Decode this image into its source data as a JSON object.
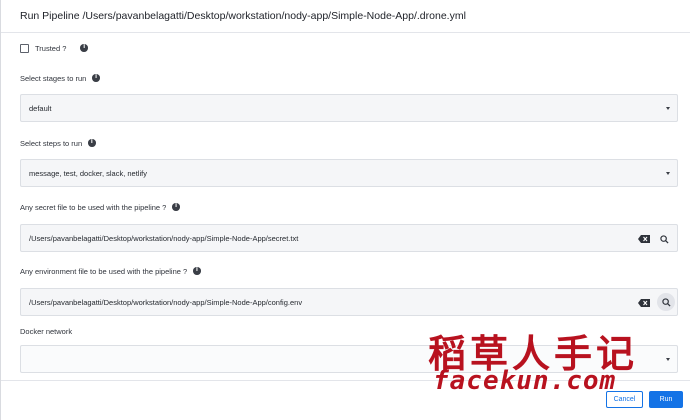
{
  "dialog": {
    "title": "Run Pipeline /Users/pavanbelagatti/Desktop/workstation/nody-app/Simple-Node-App/.drone.yml"
  },
  "trusted": {
    "label": "Trusted ?",
    "checked": false
  },
  "stages": {
    "label": "Select stages to run",
    "value": "default"
  },
  "steps": {
    "label": "Select steps to run",
    "value": "message, test, docker, slack, netlify"
  },
  "secret_file": {
    "label": "Any secret file to be used with the pipeline ?",
    "value": "/Users/pavanbelagatti/Desktop/workstation/nody-app/Simple-Node-App/secret.txt"
  },
  "env_file": {
    "label": "Any environment file to be used with the pipeline ?",
    "value": "/Users/pavanbelagatti/Desktop/workstation/nody-app/Simple-Node-App/config.env"
  },
  "docker_network": {
    "label": "Docker network",
    "value": ""
  },
  "footer": {
    "cancel_label": "Cancel",
    "run_label": "Run"
  },
  "icons": {
    "info": "info-icon",
    "clear": "backspace-clear-icon",
    "search": "search-icon",
    "dropdown": "chevron-down-icon"
  },
  "info_glyph": "i",
  "colors": {
    "accent": "#1473e6",
    "watermark": "#b8121f"
  },
  "watermark": {
    "chinese": "稻草人手记",
    "url": "facekun.com"
  }
}
